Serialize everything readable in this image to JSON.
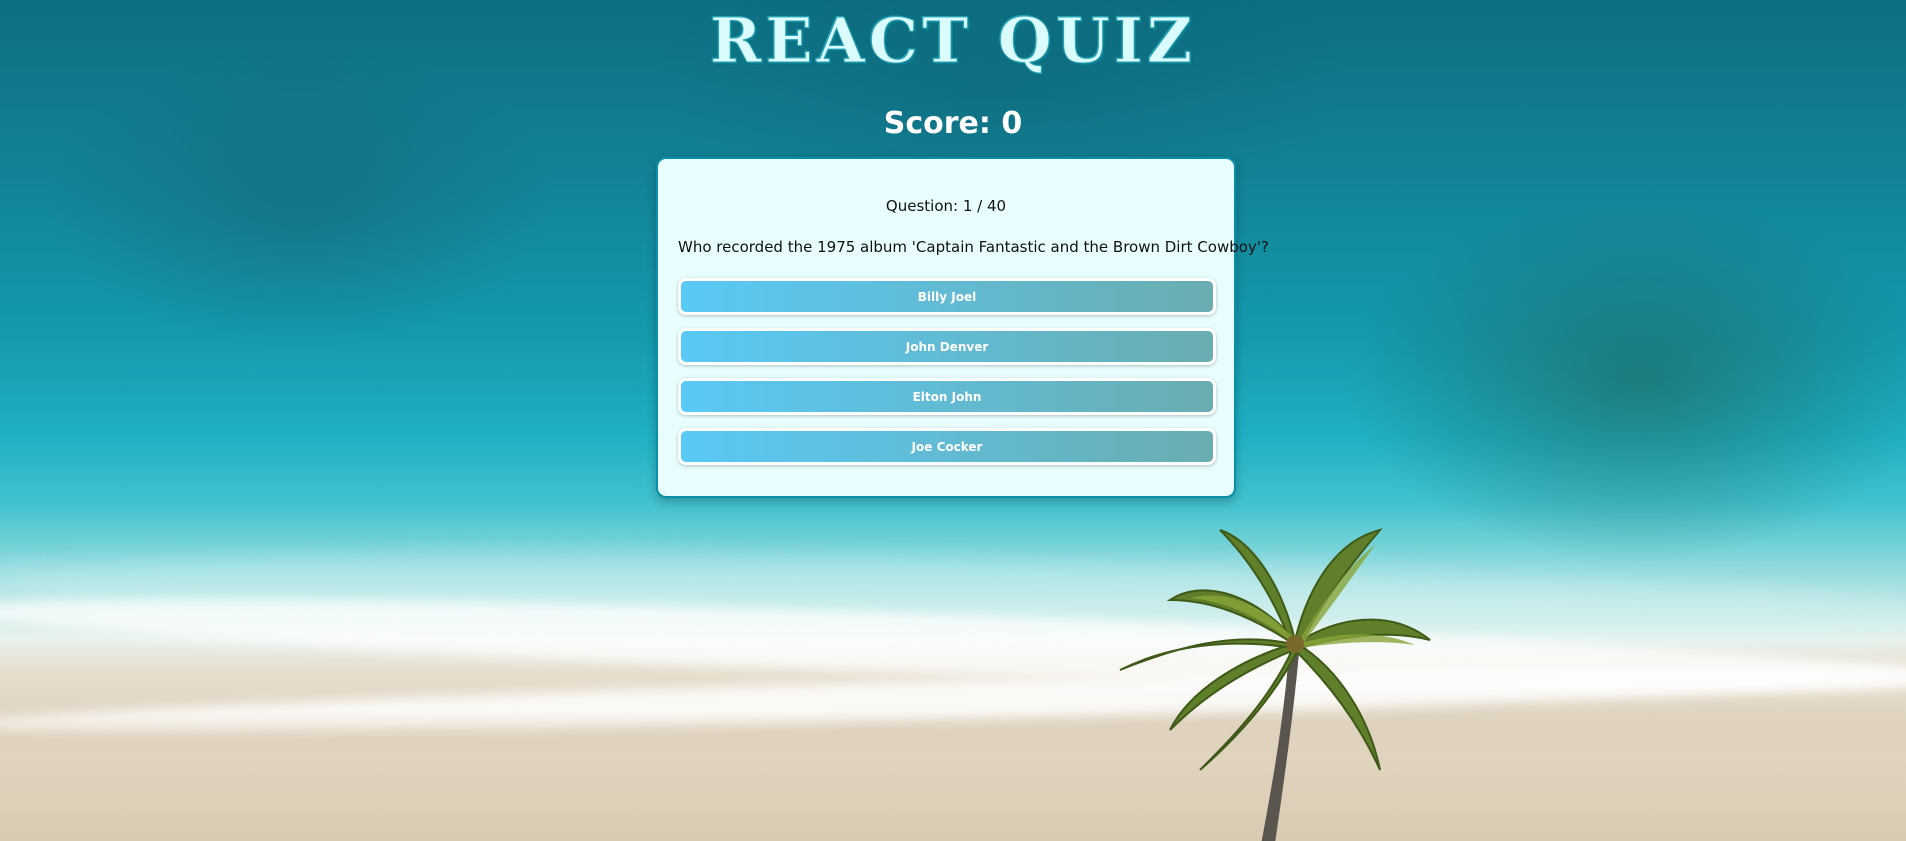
{
  "app": {
    "title": "REACT QUIZ"
  },
  "score": {
    "label": "Score: 0"
  },
  "quiz": {
    "question_number": "Question: 1 / 40",
    "question_text": "Who recorded the 1975 album 'Captain Fantastic and the Brown Dirt Cowboy'?",
    "answers": [
      {
        "label": "Billy Joel"
      },
      {
        "label": "John Denver"
      },
      {
        "label": "Elton John"
      },
      {
        "label": "Joe Cocker"
      }
    ]
  },
  "colors": {
    "card_background": "#e8fefe",
    "card_border": "#0b8fa8",
    "answer_gradient_start": "#59c9f6",
    "answer_gradient_end": "#69adb0",
    "title_fill": "#dafcff"
  },
  "background": {
    "scene": "ocean-beach-palm-tree"
  }
}
